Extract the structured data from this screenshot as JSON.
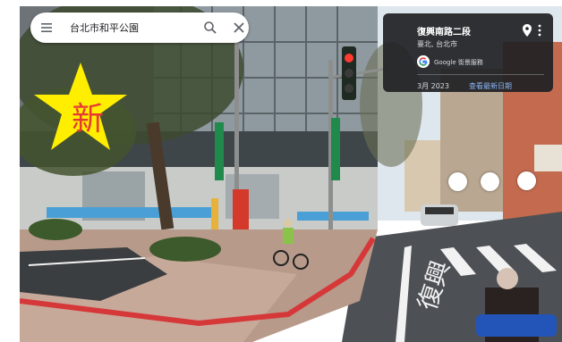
{
  "search": {
    "value": "台北市和平公園"
  },
  "card": {
    "title": "復興南路二段",
    "subtitle": "臺北, 台北市",
    "source": "Google 街景服務",
    "date": "3月 2023",
    "latest_link": "查看最新日期"
  },
  "badge": {
    "text": "新"
  },
  "scene_signs": {
    "road_marking": "復興"
  },
  "colors": {
    "card_bg": "#202124",
    "link": "#8ab4f8",
    "badge_star": "#ffee00",
    "badge_text": "#e53935"
  },
  "icons": [
    "menu-icon",
    "search-icon",
    "close-icon",
    "pin-icon",
    "more-vert-icon",
    "google-logo-icon"
  ]
}
